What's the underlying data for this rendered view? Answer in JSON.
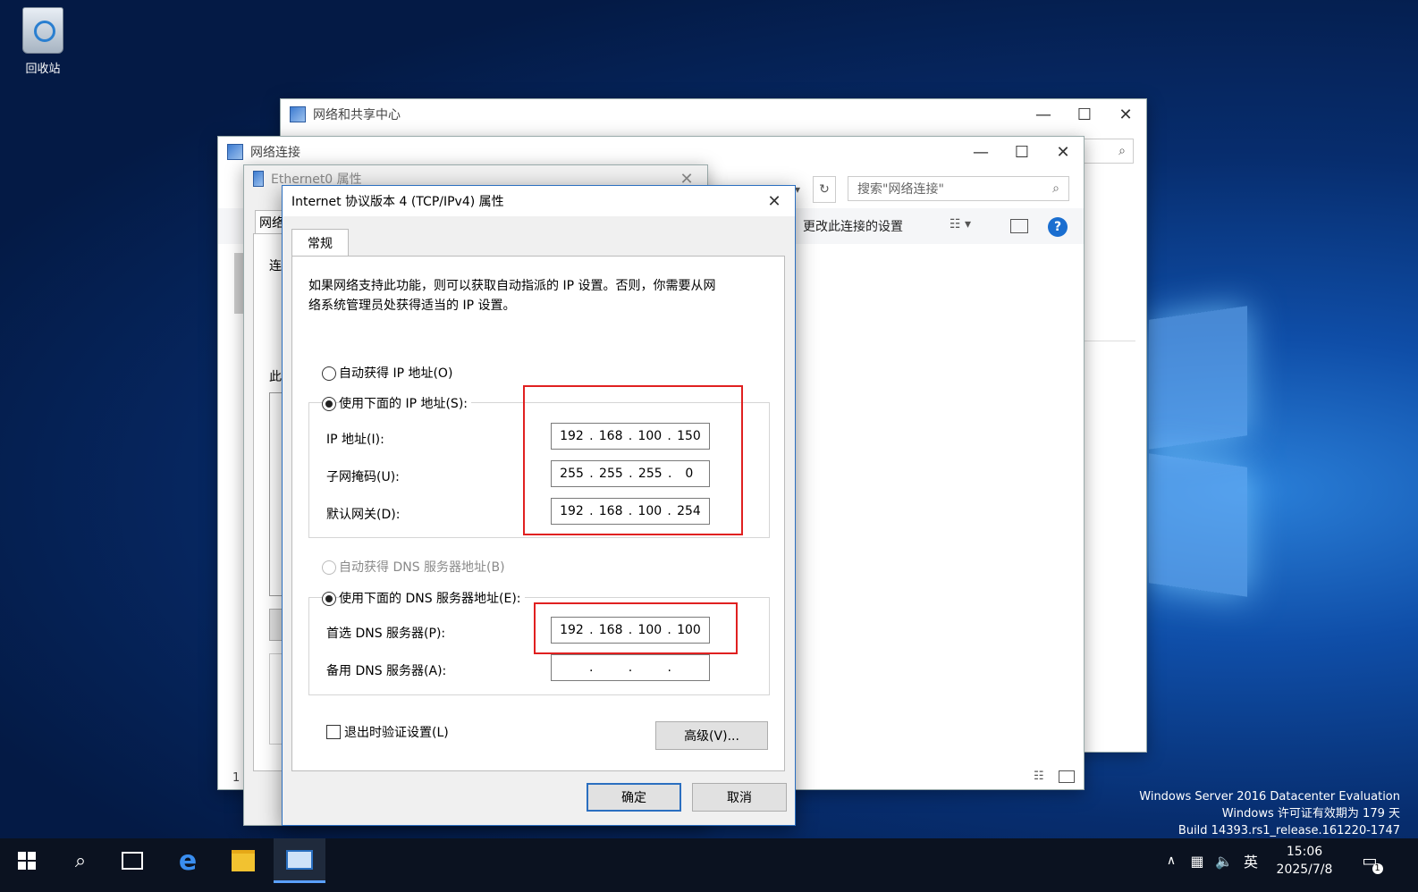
{
  "desktop": {
    "recycle_bin_label": "回收站",
    "watermark": {
      "line1": "Windows Server 2016 Datacenter Evaluation",
      "line2": "Windows 许可证有效期为 179 天",
      "line3": "Build 14393.rs1_release.161220-1747"
    }
  },
  "window_network_center": {
    "title": "网络和共享中心"
  },
  "window_network_connections": {
    "title": "网络连接",
    "search_placeholder": "搜索\"网络连接\"",
    "toolbar_change_settings": "更改此连接的设置",
    "status_count": "1"
  },
  "window_ethernet_properties": {
    "title": "Ethernet0 属性",
    "tab_label": "网络",
    "partial_labels": [
      "连",
      "此"
    ]
  },
  "dialog": {
    "title": "Internet 协议版本 4 (TCP/IPv4) 属性",
    "tab": "常规",
    "description_line1": "如果网络支持此功能，则可以获取自动指派的 IP 设置。否则，你需要从网",
    "description_line2": "络系统管理员处获得适当的 IP 设置。",
    "radio_auto_ip": "自动获得 IP 地址(O)",
    "radio_manual_ip": "使用下面的 IP 地址(S):",
    "ip_label": "IP 地址(I):",
    "subnet_label": "子网掩码(U):",
    "gateway_label": "默认网关(D):",
    "ip_address": [
      "192",
      "168",
      "100",
      "150"
    ],
    "subnet_mask": [
      "255",
      "255",
      "255",
      "0"
    ],
    "default_gateway": [
      "192",
      "168",
      "100",
      "254"
    ],
    "radio_auto_dns": "自动获得 DNS 服务器地址(B)",
    "radio_manual_dns": "使用下面的 DNS 服务器地址(E):",
    "preferred_dns_label": "首选 DNS 服务器(P):",
    "alternate_dns_label": "备用 DNS 服务器(A):",
    "preferred_dns": [
      "192",
      "168",
      "100",
      "100"
    ],
    "alternate_dns": [
      "",
      "",
      "",
      ""
    ],
    "validate_checkbox": "退出时验证设置(L)",
    "advanced_button": "高级(V)...",
    "ok_button": "确定",
    "cancel_button": "取消"
  },
  "taskbar": {
    "time": "15:06",
    "date": "2025/7/8",
    "ime": "英",
    "notification_count": "1"
  }
}
